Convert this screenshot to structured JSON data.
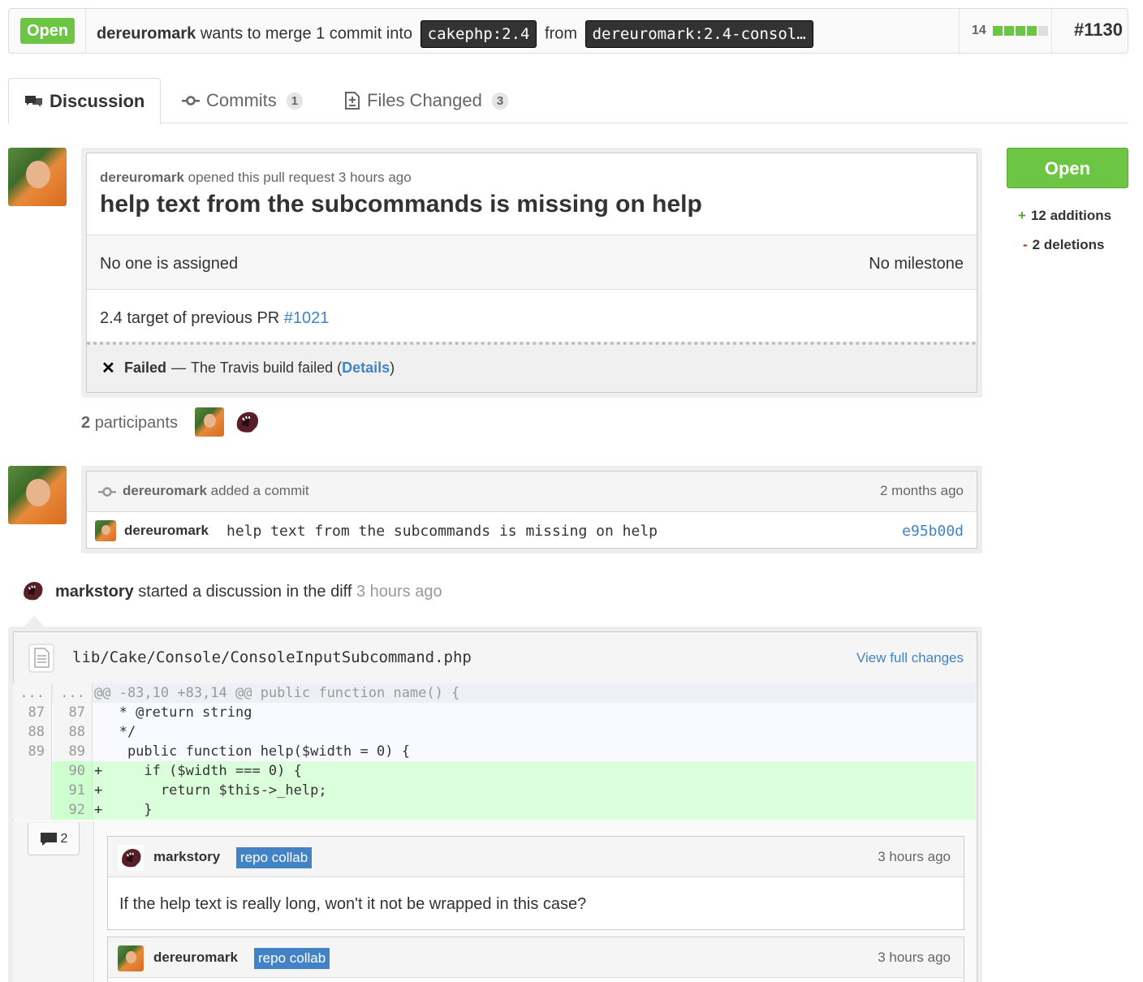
{
  "header": {
    "state": "Open",
    "author": "dereuromark",
    "message": "wants to merge 1 commit into",
    "base_ref": "cakephp:2.4",
    "from_label": "from",
    "head_ref": "dereuromark:2.4-consol…",
    "diffstat_count": "14",
    "diffstat": {
      "added_blocks": 4,
      "neutral_blocks": 1
    },
    "number": "#1130"
  },
  "tabs": [
    {
      "label": "Discussion",
      "icon": "comment-discussion-icon"
    },
    {
      "label": "Commits",
      "count": "1",
      "icon": "commit-icon"
    },
    {
      "label": "Files Changed",
      "count": "3",
      "icon": "file-diff-icon"
    }
  ],
  "pr": {
    "author": "dereuromark",
    "opened_text": "opened this pull request 3 hours ago",
    "title": "help text from the subcommands is missing on help",
    "assignee": "No one is assigned",
    "milestone": "No milestone",
    "body_text": "2.4 target of previous PR",
    "body_link": "#1021",
    "build_icon": "x-icon",
    "build_status": "Failed",
    "build_dash": "—",
    "build_text": "The Travis build failed (",
    "build_link": "Details",
    "build_close": ")"
  },
  "participants": {
    "count": "2",
    "label": "participants"
  },
  "sidebar": {
    "button": "Open",
    "additions_sign": "+",
    "additions": "12 additions",
    "deletions_sign": "-",
    "deletions": "2 deletions"
  },
  "commit_event": {
    "author": "dereuromark",
    "text": "added a commit",
    "time": "2 months ago",
    "commit_author": "dereuromark",
    "commit_message": "help text from the subcommands is missing on help",
    "sha": "e95b00d"
  },
  "discussion_event": {
    "author": "markstory",
    "text": "started a discussion in the diff",
    "time": "3 hours ago"
  },
  "diff": {
    "path": "lib/Cake/Console/ConsoleInputSubcommand.php",
    "view_link": "View full changes",
    "lines": [
      {
        "old": "...",
        "new": "...",
        "code": "@@ -83,10 +83,14 @@ public function name() {",
        "kind": "hunk"
      },
      {
        "old": "87",
        "new": "87",
        "code": "   * @return string",
        "kind": "ctx"
      },
      {
        "old": "88",
        "new": "88",
        "code": "   */",
        "kind": "ctx"
      },
      {
        "old": "89",
        "new": "89",
        "code": "    public function help($width = 0) {",
        "kind": "ctx"
      },
      {
        "old": "",
        "new": "90",
        "code": "+     if ($width === 0) {",
        "kind": "add"
      },
      {
        "old": "",
        "new": "91",
        "code": "+       return $this->_help;",
        "kind": "add"
      },
      {
        "old": "",
        "new": "92",
        "code": "+     }",
        "kind": "add"
      }
    ],
    "comment_count": "2"
  },
  "comments": [
    {
      "author": "markstory",
      "badge": "repo collab",
      "time": "3 hours ago",
      "body": "If the help text is really long, won't it not be wrapped in this case?"
    },
    {
      "author": "dereuromark",
      "badge": "repo collab",
      "time": "3 hours ago",
      "body": ""
    }
  ]
}
